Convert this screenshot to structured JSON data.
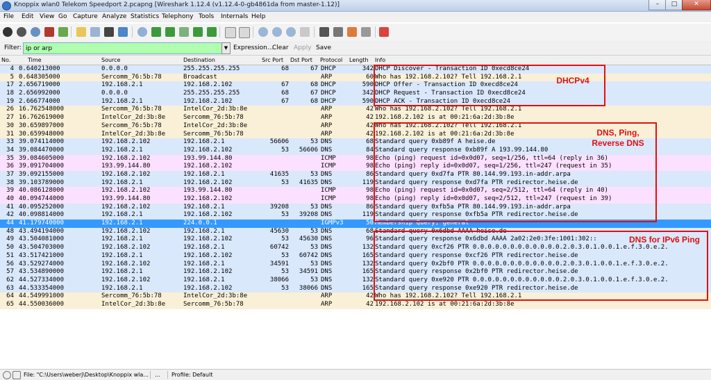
{
  "window": {
    "title": "Knoppix wlan0 Telekom Speedport 2.pcapng   [Wireshark 1.12.4  (v1.12.4-0-gb4861da from master-1.12)]",
    "min_label": "–",
    "max_label": "□",
    "close_label": "✕"
  },
  "menu": [
    "File",
    "Edit",
    "View",
    "Go",
    "Capture",
    "Analyze",
    "Statistics",
    "Telephony",
    "Tools",
    "Internals",
    "Help"
  ],
  "toolbar": {
    "icons": [
      "interfaces-icon",
      "options-icon",
      "start-capture-icon",
      "stop-capture-icon",
      "restart-capture-icon",
      "open-file-icon",
      "save-file-icon",
      "close-file-icon",
      "reload-icon",
      "find-packet-icon",
      "go-back-icon",
      "go-forward-icon",
      "go-to-packet-icon",
      "go-first-icon",
      "go-last-icon",
      "colorize-icon",
      "autoscroll-icon",
      "zoom-in-icon",
      "zoom-out-icon",
      "zoom-normal-icon",
      "resize-columns-icon",
      "capture-filters-icon",
      "display-filters-icon",
      "coloring-rules-icon",
      "preferences-icon",
      "help-icon"
    ]
  },
  "filter": {
    "label": "Filter:",
    "value": "ip or arp",
    "buttons": [
      "Expression...",
      "Clear",
      "Apply",
      "Save"
    ]
  },
  "columns": [
    "No.",
    "Time",
    "Source",
    "Destination",
    "Src Port",
    "Dst Port",
    "Protocol",
    "Length",
    "Info"
  ],
  "colors": {
    "udp": "#dae8fc",
    "arp": "#faf0d7",
    "icmp": "#fce0ff",
    "igmp": "#fff3d6",
    "selected": "#3399ff",
    "annotation": "#e01010",
    "filter_ok": "#afffaf"
  },
  "packets": [
    {
      "no": "4",
      "time": "0.640213000",
      "src": "0.0.0.0",
      "dst": "255.255.255.255",
      "sport": "68",
      "dport": "67",
      "proto": "DHCP",
      "len": "342",
      "info": "DHCP Discover - Transaction ID 0xecd8ce24",
      "color": "#dae8fc"
    },
    {
      "no": "5",
      "time": "0.648305000",
      "src": "Sercomm_76:5b:78",
      "dst": "Broadcast",
      "sport": "",
      "dport": "",
      "proto": "ARP",
      "len": "60",
      "info": "Who has 192.168.2.102?  Tell 192.168.2.1",
      "color": "#faf0d7"
    },
    {
      "no": "17",
      "time": "2.656719000",
      "src": "192.168.2.1",
      "dst": "192.168.2.102",
      "sport": "67",
      "dport": "68",
      "proto": "DHCP",
      "len": "590",
      "info": "DHCP Offer    - Transaction ID 0xecd8ce24",
      "color": "#dae8fc"
    },
    {
      "no": "18",
      "time": "2.656992000",
      "src": "0.0.0.0",
      "dst": "255.255.255.255",
      "sport": "68",
      "dport": "67",
      "proto": "DHCP",
      "len": "342",
      "info": "DHCP Request  - Transaction ID 0xecd8ce24",
      "color": "#dae8fc"
    },
    {
      "no": "19",
      "time": "2.666774000",
      "src": "192.168.2.1",
      "dst": "192.168.2.102",
      "sport": "67",
      "dport": "68",
      "proto": "DHCP",
      "len": "590",
      "info": "DHCP ACK      - Transaction ID 0xecd8ce24",
      "color": "#dae8fc"
    },
    {
      "no": "26",
      "time": "16.762548000",
      "src": "Sercomm_76:5b:78",
      "dst": "IntelCor_2d:3b:8e",
      "sport": "",
      "dport": "",
      "proto": "ARP",
      "len": "42",
      "info": "Who has 192.168.2.102?  Tell 192.168.2.1",
      "color": "#faf0d7"
    },
    {
      "no": "27",
      "time": "16.762619000",
      "src": "IntelCor_2d:3b:8e",
      "dst": "Sercomm_76:5b:78",
      "sport": "",
      "dport": "",
      "proto": "ARP",
      "len": "42",
      "info": "192.168.2.102 is at 00:21:6a:2d:3b:8e",
      "color": "#faf0d7"
    },
    {
      "no": "30",
      "time": "30.659897000",
      "src": "Sercomm_76:5b:78",
      "dst": "IntelCor_2d:3b:8e",
      "sport": "",
      "dport": "",
      "proto": "ARP",
      "len": "42",
      "info": "Who has 192.168.2.102?  Tell 192.168.2.1",
      "color": "#faf0d7"
    },
    {
      "no": "31",
      "time": "30.659948000",
      "src": "IntelCor_2d:3b:8e",
      "dst": "Sercomm_76:5b:78",
      "sport": "",
      "dport": "",
      "proto": "ARP",
      "len": "42",
      "info": "192.168.2.102 is at 00:21:6a:2d:3b:8e",
      "color": "#faf0d7"
    },
    {
      "no": "33",
      "time": "39.074114000",
      "src": "192.168.2.102",
      "dst": "192.168.2.1",
      "sport": "56606",
      "dport": "53",
      "proto": "DNS",
      "len": "68",
      "info": "Standard query 0xb89f  A heise.de",
      "color": "#dae8fc"
    },
    {
      "no": "34",
      "time": "39.084470000",
      "src": "192.168.2.1",
      "dst": "192.168.2.102",
      "sport": "53",
      "dport": "56606",
      "proto": "DNS",
      "len": "84",
      "info": "Standard query response 0xb89f  A 193.99.144.80",
      "color": "#dae8fc"
    },
    {
      "no": "35",
      "time": "39.084605000",
      "src": "192.168.2.102",
      "dst": "193.99.144.80",
      "sport": "",
      "dport": "",
      "proto": "ICMP",
      "len": "98",
      "info": "Echo (ping) request  id=0x0d07, seq=1/256, ttl=64 (reply in 36)",
      "color": "#fce0ff"
    },
    {
      "no": "36",
      "time": "39.091704000",
      "src": "193.99.144.80",
      "dst": "192.168.2.102",
      "sport": "",
      "dport": "",
      "proto": "ICMP",
      "len": "98",
      "info": "Echo (ping) reply    id=0x0d07, seq=1/256, ttl=247 (request in 35)",
      "color": "#fce0ff"
    },
    {
      "no": "37",
      "time": "39.092155000",
      "src": "192.168.2.102",
      "dst": "192.168.2.1",
      "sport": "41635",
      "dport": "53",
      "proto": "DNS",
      "len": "86",
      "info": "Standard query 0xd7fa  PTR 80.144.99.193.in-addr.arpa",
      "color": "#dae8fc"
    },
    {
      "no": "38",
      "time": "39.103789000",
      "src": "192.168.2.1",
      "dst": "192.168.2.102",
      "sport": "53",
      "dport": "41635",
      "proto": "DNS",
      "len": "119",
      "info": "Standard query response 0xd7fa  PTR redirector.heise.de",
      "color": "#dae8fc"
    },
    {
      "no": "39",
      "time": "40.086128000",
      "src": "192.168.2.102",
      "dst": "193.99.144.80",
      "sport": "",
      "dport": "",
      "proto": "ICMP",
      "len": "98",
      "info": "Echo (ping) request  id=0x0d07, seq=2/512, ttl=64 (reply in 40)",
      "color": "#fce0ff"
    },
    {
      "no": "40",
      "time": "40.094744000",
      "src": "193.99.144.80",
      "dst": "192.168.2.102",
      "sport": "",
      "dport": "",
      "proto": "ICMP",
      "len": "98",
      "info": "Echo (ping) reply    id=0x0d07, seq=2/512, ttl=247 (request in 39)",
      "color": "#fce0ff"
    },
    {
      "no": "41",
      "time": "40.095252000",
      "src": "192.168.2.102",
      "dst": "192.168.2.1",
      "sport": "39208",
      "dport": "53",
      "proto": "DNS",
      "len": "86",
      "info": "Standard query 0xfb5a  PTR 80.144.99.193.in-addr.arpa",
      "color": "#dae8fc"
    },
    {
      "no": "42",
      "time": "40.098814000",
      "src": "192.168.2.1",
      "dst": "192.168.2.102",
      "sport": "53",
      "dport": "39208",
      "proto": "DNS",
      "len": "119",
      "info": "Standard query response 0xfb5a  PTR redirector.heise.de",
      "color": "#dae8fc"
    },
    {
      "no": "44",
      "time": "41.179740000",
      "src": "192.168.2.1",
      "dst": "224.0.0.1",
      "sport": "",
      "dport": "",
      "proto": "IGMPv3",
      "len": "50",
      "info": "Membership Query, general",
      "color": "#3399ff",
      "selected": true
    },
    {
      "no": "48",
      "time": "43.494194000",
      "src": "192.168.2.102",
      "dst": "192.168.2.1",
      "sport": "45630",
      "dport": "53",
      "proto": "DNS",
      "len": "68",
      "info": "Standard query 0x6dbd  AAAA heise.de",
      "color": "#dae8fc"
    },
    {
      "no": "49",
      "time": "43.504081000",
      "src": "192.168.2.1",
      "dst": "192.168.2.102",
      "sport": "53",
      "dport": "45630",
      "proto": "DNS",
      "len": "96",
      "info": "Standard query response 0x6dbd  AAAA 2a02:2e0:3fe:1001:302::",
      "color": "#dae8fc"
    },
    {
      "no": "50",
      "time": "43.504703000",
      "src": "192.168.2.102",
      "dst": "192.168.2.1",
      "sport": "60742",
      "dport": "53",
      "proto": "DNS",
      "len": "132",
      "info": "Standard query 0xcf26  PTR 0.0.0.0.0.0.0.0.0.0.0.0.2.0.3.0.1.0.0.1.e.f.3.0.e.2.",
      "color": "#dae8fc"
    },
    {
      "no": "51",
      "time": "43.517421000",
      "src": "192.168.2.1",
      "dst": "192.168.2.102",
      "sport": "53",
      "dport": "60742",
      "proto": "DNS",
      "len": "165",
      "info": "Standard query response 0xcf26  PTR redirector.heise.de",
      "color": "#dae8fc"
    },
    {
      "no": "56",
      "time": "43.529274000",
      "src": "192.168.2.102",
      "dst": "192.168.2.1",
      "sport": "34591",
      "dport": "53",
      "proto": "DNS",
      "len": "132",
      "info": "Standard query 0x2bf0  PTR 0.0.0.0.0.0.0.0.0.0.0.0.2.0.3.0.1.0.0.1.e.f.3.0.e.2.",
      "color": "#dae8fc"
    },
    {
      "no": "57",
      "time": "43.534890000",
      "src": "192.168.2.1",
      "dst": "192.168.2.102",
      "sport": "53",
      "dport": "34591",
      "proto": "DNS",
      "len": "165",
      "info": "Standard query response 0x2bf0  PTR redirector.heise.de",
      "color": "#dae8fc"
    },
    {
      "no": "62",
      "time": "44.527334000",
      "src": "192.168.2.102",
      "dst": "192.168.2.1",
      "sport": "38066",
      "dport": "53",
      "proto": "DNS",
      "len": "132",
      "info": "Standard query 0xe920  PTR 0.0.0.0.0.0.0.0.0.0.0.0.2.0.3.0.1.0.0.1.e.f.3.0.e.2.",
      "color": "#dae8fc"
    },
    {
      "no": "63",
      "time": "44.533354000",
      "src": "192.168.2.1",
      "dst": "192.168.2.102",
      "sport": "53",
      "dport": "38066",
      "proto": "DNS",
      "len": "165",
      "info": "Standard query response 0xe920  PTR redirector.heise.de",
      "color": "#dae8fc"
    },
    {
      "no": "64",
      "time": "44.549991000",
      "src": "Sercomm_76:5b:78",
      "dst": "IntelCor_2d:3b:8e",
      "sport": "",
      "dport": "",
      "proto": "ARP",
      "len": "42",
      "info": "Who has 192.168.2.102?  Tell 192.168.2.1",
      "color": "#faf0d7"
    },
    {
      "no": "65",
      "time": "44.550036000",
      "src": "IntelCor_2d:3b:8e",
      "dst": "Sercomm_76:5b:78",
      "sport": "",
      "dport": "",
      "proto": "ARP",
      "len": "42",
      "info": "192.168.2.102 is at 00:21:6a:2d:3b:8e",
      "color": "#faf0d7"
    }
  ],
  "annotations": {
    "dhcp": "DHCPv4",
    "dns_line1": "DNS, Ping,",
    "dns_line2": "Reverse DNS",
    "ipv6": "DNS for IPv6 Ping"
  },
  "status": {
    "file": "File: \"C:\\Users\\weberj\\Desktop\\Knoppix wla...",
    "middle": "...",
    "profile": "Profile: Default"
  }
}
